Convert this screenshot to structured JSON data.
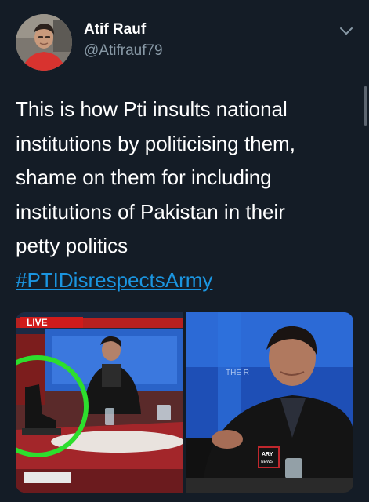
{
  "tweet": {
    "author": {
      "display_name": "Atif Rauf",
      "handle": "@Atifrauf79",
      "avatar_icon": "profile-photo"
    },
    "text_lines": [
      "This is how Pti insults national",
      "institutions by politicising them,",
      "shame on them for including",
      "institutions of Pakistan in their",
      "petty politics"
    ],
    "hashtag": "#PTIDisrespectsArmy",
    "menu_icon": "chevron-down-icon",
    "media": [
      {
        "kind": "tv-screenshot",
        "badge": "LIVE",
        "highlight_color": "#2dde2d"
      },
      {
        "kind": "tv-screenshot",
        "backdrop_text": "THE R",
        "mic_label_top": "ARY",
        "mic_label_bottom": "NEWS"
      }
    ]
  },
  "colors": {
    "background": "#141c26",
    "text": "#ffffff",
    "secondary_text": "#8899a6",
    "link": "#1b95e0"
  }
}
